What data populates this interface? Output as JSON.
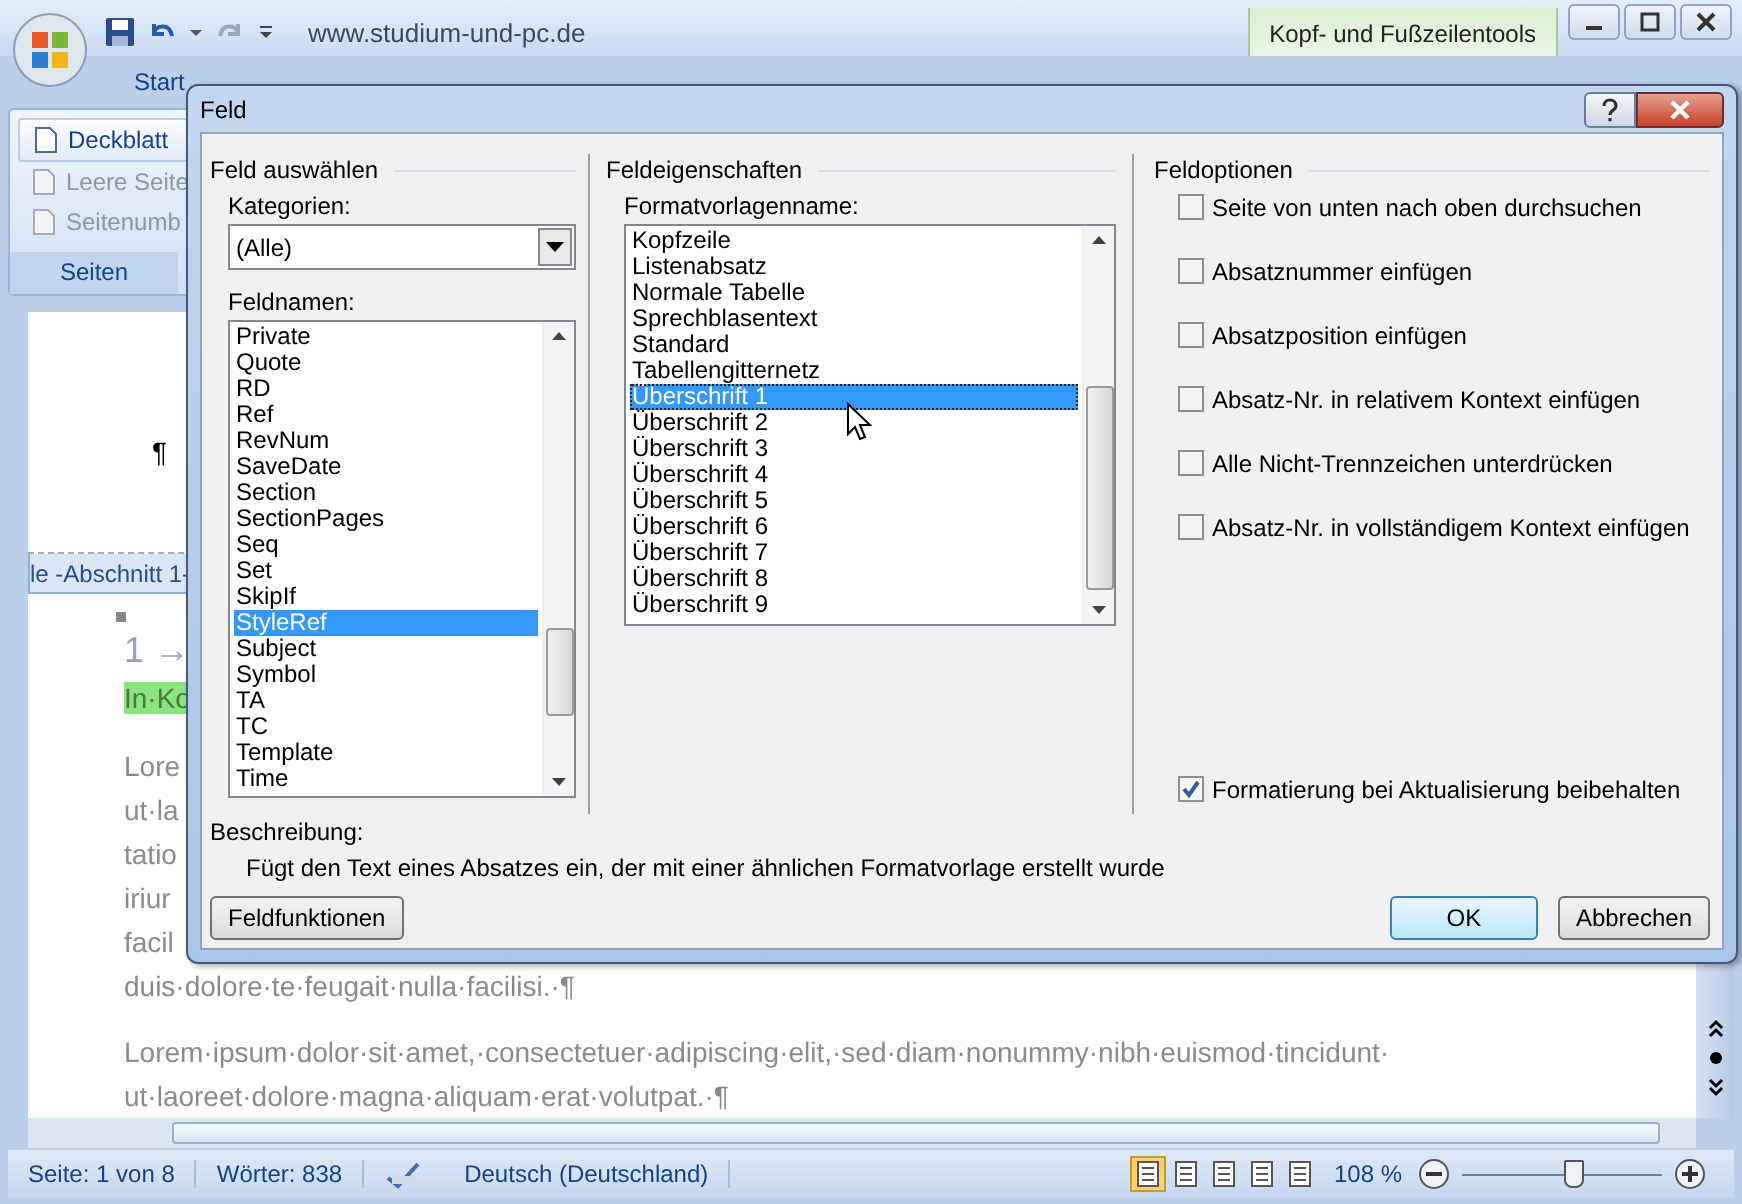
{
  "word": {
    "address": "www.studium-und-pc.de",
    "contextual_tab": "Kopf- und Fußzeilentools",
    "tab": "Start",
    "ribbon_group": {
      "title": "Seiten",
      "items": [
        {
          "label": "Deckblatt",
          "disabled": false
        },
        {
          "label": "Leere Seite",
          "disabled": true
        },
        {
          "label": "Seitenumb",
          "disabled": true
        }
      ]
    },
    "document": {
      "header_mark": "¶",
      "section_label": "le -Abschnitt 1-",
      "paragraphs": [
        {
          "kind": "heading",
          "lines": [
            "1 →"
          ]
        },
        {
          "kind": "highlight",
          "lines": [
            "In·Ko"
          ]
        },
        {
          "kind": "body",
          "lines": [
            "Lore",
            "ut·la",
            "tatio",
            "iriur",
            "facil",
            "duis·dolore·te·feugait·nulla·facilisi.·¶"
          ]
        },
        {
          "kind": "body",
          "lines": [
            "Lorem·ipsum·dolor·sit·amet,·consectetuer·adipiscing·elit,·sed·diam·nonummy·nibh·euismod·tincidunt·",
            "ut·laoreet·dolore·magna·aliquam·erat·volutpat.·¶"
          ]
        }
      ]
    },
    "status": {
      "page": "Seite: 1 von 8",
      "words": "Wörter: 838",
      "language": "Deutsch (Deutschland)",
      "zoom": "108 %",
      "views": [
        {
          "selected": true
        },
        {
          "selected": false
        },
        {
          "selected": false
        },
        {
          "selected": false
        },
        {
          "selected": false
        }
      ],
      "zoom_slider": {
        "level": 0.55
      }
    }
  },
  "dialog": {
    "title": "Feld",
    "select": {
      "title": "Feld auswählen",
      "categories_label": "Kategorien:",
      "category": "(Alle)",
      "names_label": "Feldnamen:",
      "names": [
        {
          "label": "Private",
          "selected": false
        },
        {
          "label": "Quote",
          "selected": false
        },
        {
          "label": "RD",
          "selected": false
        },
        {
          "label": "Ref",
          "selected": false
        },
        {
          "label": "RevNum",
          "selected": false
        },
        {
          "label": "SaveDate",
          "selected": false
        },
        {
          "label": "Section",
          "selected": false
        },
        {
          "label": "SectionPages",
          "selected": false
        },
        {
          "label": "Seq",
          "selected": false
        },
        {
          "label": "Set",
          "selected": false
        },
        {
          "label": "SkipIf",
          "selected": false
        },
        {
          "label": "StyleRef",
          "selected": true
        },
        {
          "label": "Subject",
          "selected": false
        },
        {
          "label": "Symbol",
          "selected": false
        },
        {
          "label": "TA",
          "selected": false
        },
        {
          "label": "TC",
          "selected": false
        },
        {
          "label": "Template",
          "selected": false
        },
        {
          "label": "Time",
          "selected": false
        }
      ]
    },
    "properties": {
      "title": "Feldeigenschaften",
      "styles_label": "Formatvorlagenname:",
      "styles": [
        {
          "label": "Kopfzeile",
          "selected": false
        },
        {
          "label": "Listenabsatz",
          "selected": false
        },
        {
          "label": "Normale Tabelle",
          "selected": false
        },
        {
          "label": "Sprechblasentext",
          "selected": false
        },
        {
          "label": "Standard",
          "selected": false
        },
        {
          "label": "Tabellengitternetz",
          "selected": false
        },
        {
          "label": "Überschrift 1",
          "selected": true
        },
        {
          "label": "Überschrift 2",
          "selected": false
        },
        {
          "label": "Überschrift 3",
          "selected": false
        },
        {
          "label": "Überschrift 4",
          "selected": false
        },
        {
          "label": "Überschrift 5",
          "selected": false
        },
        {
          "label": "Überschrift 6",
          "selected": false
        },
        {
          "label": "Überschrift 7",
          "selected": false
        },
        {
          "label": "Überschrift 8",
          "selected": false
        },
        {
          "label": "Überschrift 9",
          "selected": false
        }
      ]
    },
    "options": {
      "title": "Feldoptionen",
      "checkboxes": [
        {
          "label": "Seite von unten nach oben durchsuchen",
          "checked": false
        },
        {
          "label": "Absatznummer einfügen",
          "checked": false
        },
        {
          "label": "Absatzposition einfügen",
          "checked": false
        },
        {
          "label": "Absatz-Nr. in relativem Kontext einfügen",
          "checked": false
        },
        {
          "label": "Alle Nicht-Trennzeichen unterdrücken",
          "checked": false
        },
        {
          "label": "Absatz-Nr. in vollständigem Kontext einfügen",
          "checked": false
        }
      ],
      "preserve": {
        "label": "Formatierung bei Aktualisierung beibehalten",
        "checked": true
      }
    },
    "description_label": "Beschreibung:",
    "description": "Fügt den Text eines Absatzes ein, der mit einer ähnlichen Formatvorlage erstellt wurde",
    "buttons": [
      {
        "label": "Feldfunktionen",
        "kind": "left"
      },
      {
        "label": "OK",
        "kind": "default"
      },
      {
        "label": "Abbrechen",
        "kind": "normal"
      }
    ]
  }
}
